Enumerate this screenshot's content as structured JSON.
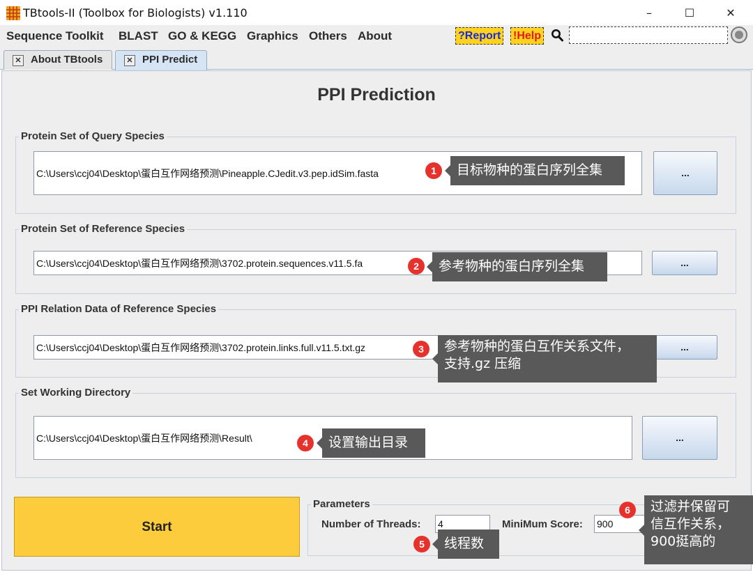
{
  "window": {
    "title": "TBtools-II (Toolbox for Biologists) v1.110",
    "minimize": "–",
    "maximize": "☐",
    "close": "✕"
  },
  "menu": {
    "items": [
      "Sequence Toolkit",
      "BLAST",
      "GO & KEGG",
      "Graphics",
      "Others",
      "About"
    ],
    "report_label": "?Report",
    "help_label": "!Help",
    "search_value": ""
  },
  "tabs": [
    {
      "label": "About TBtools",
      "active": false
    },
    {
      "label": "PPI Predict",
      "active": true
    }
  ],
  "page": {
    "title": "PPI Prediction"
  },
  "sections": [
    {
      "title": "Protein Set of Query Species",
      "value": "C:\\Users\\ccj04\\Desktop\\蛋白互作网络预测\\Pineapple.CJedit.v3.pep.idSim.fasta",
      "browse_label": "..."
    },
    {
      "title": "Protein Set of Reference Species",
      "value": "C:\\Users\\ccj04\\Desktop\\蛋白互作网络预测\\3702.protein.sequences.v11.5.fa",
      "browse_label": "..."
    },
    {
      "title": "PPI Relation Data of Reference Species",
      "value": "C:\\Users\\ccj04\\Desktop\\蛋白互作网络预测\\3702.protein.links.full.v11.5.txt.gz",
      "browse_label": "..."
    },
    {
      "title": "Set Working Directory",
      "value": "C:\\Users\\ccj04\\Desktop\\蛋白互作网络预测\\Result\\",
      "browse_label": "..."
    }
  ],
  "start": {
    "label": "Start"
  },
  "parameters": {
    "title": "Parameters",
    "threads_label": "Number of Threads:",
    "threads_value": "4",
    "score_label": "MiniMum Score:",
    "score_value": "900"
  },
  "annotations": [
    {
      "number": "1",
      "text": "目标物种的蛋白序列全集"
    },
    {
      "number": "2",
      "text": "参考物种的蛋白序列全集"
    },
    {
      "number": "3",
      "line1": "参考物种的蛋白互作关系文件，",
      "line2": "支持.gz 压缩"
    },
    {
      "number": "4",
      "text": "设置输出目录"
    },
    {
      "number": "5",
      "text": "线程数"
    },
    {
      "number": "6",
      "line1": "过滤并保留可",
      "line2": "信互作关系，",
      "line3": "900挺高的"
    }
  ],
  "colors": {
    "accent_yellow": "#fccc3c",
    "badge_red": "#e5322d",
    "callout_gray": "#595959"
  }
}
